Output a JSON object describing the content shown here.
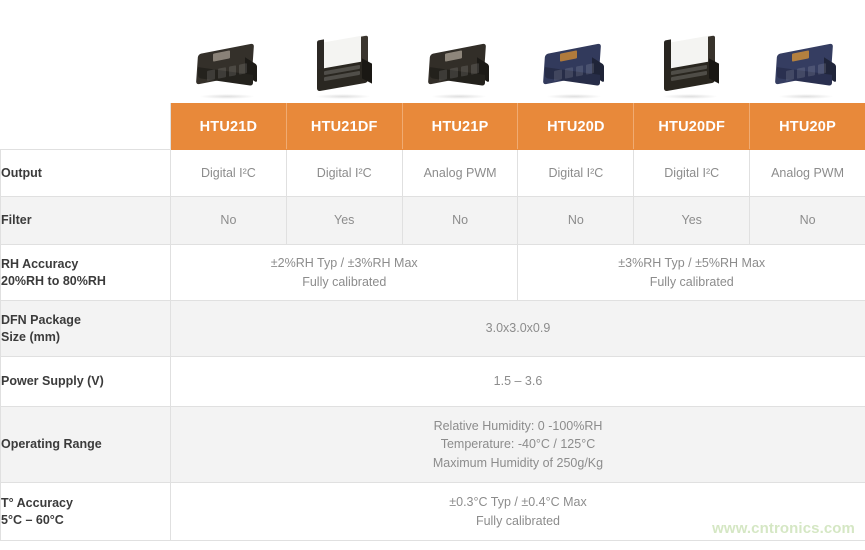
{
  "products": [
    {
      "model": "HTU21D",
      "chip_style": "flat",
      "chip_color": "#2e2b26",
      "has_filter_cap": false
    },
    {
      "model": "HTU21DF",
      "chip_style": "cap",
      "chip_color": "#26241f",
      "has_filter_cap": true
    },
    {
      "model": "HTU21P",
      "chip_style": "flat",
      "chip_color": "#2a2721",
      "has_filter_cap": false
    },
    {
      "model": "HTU20D",
      "chip_style": "flat",
      "chip_color": "#2d3352",
      "has_filter_cap": false
    },
    {
      "model": "HTU20DF",
      "chip_style": "cap",
      "chip_color": "#23211c",
      "has_filter_cap": true
    },
    {
      "model": "HTU20P",
      "chip_style": "flat",
      "chip_color": "#2f3655",
      "has_filter_cap": false
    }
  ],
  "table": {
    "headers": [
      "HTU21D",
      "HTU21DF",
      "HTU21P",
      "HTU20D",
      "HTU20DF",
      "HTU20P"
    ],
    "rows": [
      {
        "label": "Output",
        "cells": [
          "Digital I²C",
          "Digital I²C",
          "Analog PWM",
          "Digital I²C",
          "Digital I²C",
          "Analog PWM"
        ]
      },
      {
        "label": "Filter",
        "cells": [
          "No",
          "Yes",
          "No",
          "No",
          "Yes",
          "No"
        ]
      },
      {
        "label": "RH Accuracy\n20%RH to 80%RH",
        "merged": [
          "±2%RH Typ / ±3%RH Max\nFully calibrated",
          "±3%RH Typ / ±5%RH Max\nFully calibrated"
        ]
      },
      {
        "label": "DFN Package\nSize (mm)",
        "full": "3.0x3.0x0.9"
      },
      {
        "label": "Power Supply (V)",
        "full": "1.5 – 3.6"
      },
      {
        "label": "Operating Range",
        "full": "Relative Humidity: 0 -100%RH\nTemperature: -40°C / 125°C\nMaximum Humidity of 250g/Kg"
      },
      {
        "label": "T° Accuracy\n5°C – 60°C",
        "full": "±0.3°C Typ / ±0.4°C Max\nFully calibrated"
      }
    ]
  },
  "watermark": "www.cntronics.com",
  "colors": {
    "header_orange": "#e8893a",
    "row_shaded": "#f3f3f3",
    "row_white": "#ffffff",
    "label_text": "#3b3b3b",
    "value_text": "#8c8c8c",
    "border": "#e0e0e0",
    "watermark_green": "#d5e7c4"
  }
}
